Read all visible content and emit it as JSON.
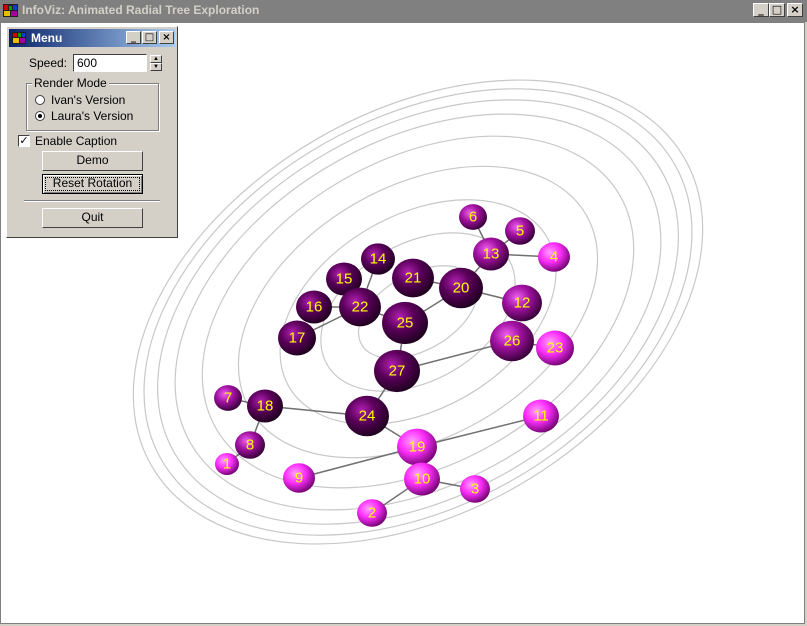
{
  "window": {
    "title": "InfoViz: Animated Radial Tree Exploration",
    "controls": [
      "_",
      "□",
      "×"
    ]
  },
  "menu": {
    "title": "Menu",
    "controls": [
      "_",
      "□",
      "×"
    ],
    "speed_label": "Speed:",
    "speed_value": "600",
    "render_mode": {
      "title": "Render Mode",
      "options": [
        {
          "label": "Ivan's Version",
          "selected": false
        },
        {
          "label": "Laura's Version",
          "selected": true
        }
      ]
    },
    "enable_caption": {
      "label": "Enable Caption",
      "checked": true
    },
    "buttons": {
      "demo": "Demo",
      "reset_rotation": "Reset Rotation",
      "quit": "Quit"
    }
  },
  "tree": {
    "nodes": [
      {
        "id": "1",
        "tone": "bright"
      },
      {
        "id": "2",
        "tone": "bright"
      },
      {
        "id": "3",
        "tone": "bright"
      },
      {
        "id": "4",
        "tone": "bright"
      },
      {
        "id": "5",
        "tone": "mid"
      },
      {
        "id": "6",
        "tone": "mid"
      },
      {
        "id": "7",
        "tone": "mid"
      },
      {
        "id": "8",
        "tone": "mid"
      },
      {
        "id": "9",
        "tone": "bright"
      },
      {
        "id": "10",
        "tone": "bright"
      },
      {
        "id": "11",
        "tone": "bright"
      },
      {
        "id": "12",
        "tone": "mid"
      },
      {
        "id": "13",
        "tone": "mid"
      },
      {
        "id": "14",
        "tone": "dark"
      },
      {
        "id": "15",
        "tone": "dark"
      },
      {
        "id": "16",
        "tone": "dark"
      },
      {
        "id": "17",
        "tone": "dark"
      },
      {
        "id": "18",
        "tone": "dark"
      },
      {
        "id": "19",
        "tone": "bright"
      },
      {
        "id": "20",
        "tone": "dark"
      },
      {
        "id": "21",
        "tone": "dark"
      },
      {
        "id": "22",
        "tone": "dark"
      },
      {
        "id": "23",
        "tone": "bright"
      },
      {
        "id": "24",
        "tone": "dark"
      },
      {
        "id": "25",
        "tone": "dark"
      },
      {
        "id": "26",
        "tone": "mid"
      },
      {
        "id": "27",
        "tone": "dark"
      }
    ],
    "edges": [
      [
        "27",
        "25"
      ],
      [
        "27",
        "24"
      ],
      [
        "27",
        "26"
      ],
      [
        "25",
        "22"
      ],
      [
        "25",
        "20"
      ],
      [
        "22",
        "15"
      ],
      [
        "22",
        "16"
      ],
      [
        "22",
        "17"
      ],
      [
        "22",
        "14"
      ],
      [
        "20",
        "21"
      ],
      [
        "20",
        "12"
      ],
      [
        "20",
        "13"
      ],
      [
        "13",
        "6"
      ],
      [
        "13",
        "5"
      ],
      [
        "13",
        "4"
      ],
      [
        "26",
        "23"
      ],
      [
        "24",
        "18"
      ],
      [
        "24",
        "19"
      ],
      [
        "18",
        "7"
      ],
      [
        "18",
        "8"
      ],
      [
        "8",
        "1"
      ],
      [
        "19",
        "9"
      ],
      [
        "19",
        "11"
      ],
      [
        "19",
        "10"
      ],
      [
        "10",
        "2"
      ],
      [
        "10",
        "3"
      ]
    ],
    "colors": {
      "bright": "#ff40ff",
      "mid": "#c020c0",
      "dark": "#3a0038",
      "label": "#ffff00",
      "ring": "#c8c8c8",
      "edge": "#707070"
    }
  }
}
